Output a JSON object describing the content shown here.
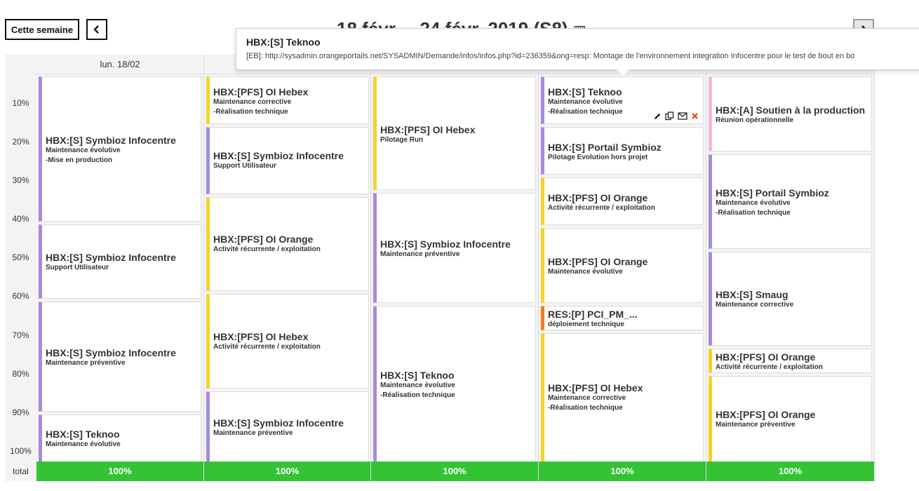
{
  "toolbar": {
    "this_week_label": "Cette semaine",
    "prev_label": "‹",
    "next_label": "›",
    "week_title": "18 févr. – 24 févr. 2019 (S8)"
  },
  "days": [
    {
      "label": "lun. 18/02"
    },
    {
      "label": ""
    },
    {
      "label": ""
    },
    {
      "label": ""
    },
    {
      "label": ""
    }
  ],
  "percent_labels": [
    "10%",
    "20%",
    "30%",
    "40%",
    "50%",
    "60%",
    "70%",
    "80%",
    "90%",
    "100%"
  ],
  "total_label": "total",
  "totals": [
    "100%",
    "100%",
    "100%",
    "100%",
    "100%"
  ],
  "colors": {
    "purple": "#a78bdb",
    "yellow": "#f5d327",
    "orange": "#f47a1f",
    "pink": "#f5b8dc",
    "total_green": "#33c333"
  },
  "events": {
    "d0": [
      {
        "title": "HBX:[S] Symbioz Infocentre",
        "lines": [
          "Maintenance évolutive",
          "-Mise en production"
        ],
        "color": "purple"
      },
      {
        "title": "HBX:[S] Symbioz Infocentre",
        "lines": [
          "Support Utilisateur"
        ],
        "color": "purple"
      },
      {
        "title": "HBX:[S] Symbioz Infocentre",
        "lines": [
          "Maintenance préventive"
        ],
        "color": "purple"
      },
      {
        "title": "HBX:[S] Teknoo",
        "lines": [
          "Maintenance évolutive"
        ],
        "color": "purple"
      }
    ],
    "d1": [
      {
        "title": "HBX:[PFS] OI Hebex",
        "lines": [
          "Maintenance corrective",
          "-Réalisation technique"
        ],
        "color": "yellow"
      },
      {
        "title": "HBX:[S] Symbioz Infocentre",
        "lines": [
          "Support Utilisateur"
        ],
        "color": "purple"
      },
      {
        "title": "HBX:[PFS] OI Orange",
        "lines": [
          "Activité récurrente / exploitation"
        ],
        "color": "yellow"
      },
      {
        "title": "HBX:[PFS] OI Hebex",
        "lines": [
          "Activité récurrente / exploitation"
        ],
        "color": "yellow"
      },
      {
        "title": "HBX:[S] Symbioz Infocentre",
        "lines": [
          "Maintenance préventive"
        ],
        "color": "purple"
      }
    ],
    "d2": [
      {
        "title": "HBX:[PFS] OI Hebex",
        "lines": [
          "Pilotage Run"
        ],
        "color": "yellow"
      },
      {
        "title": "HBX:[S] Symbioz Infocentre",
        "lines": [
          "Maintenance préventive"
        ],
        "color": "purple"
      },
      {
        "title": "HBX:[S] Teknoo",
        "lines": [
          "Maintenance évolutive",
          "-Réalisation technique"
        ],
        "color": "purple"
      }
    ],
    "d3": [
      {
        "title": "HBX:[S] Teknoo",
        "lines": [
          "Maintenance évolutive",
          "-Réalisation technique"
        ],
        "color": "purple"
      },
      {
        "title": "HBX:[S] Portail Symbioz",
        "lines": [
          "Pilotage Evolution hors projet"
        ],
        "color": "purple"
      },
      {
        "title": "HBX:[PFS] OI Orange",
        "lines": [
          "Activité récurrente / exploitation"
        ],
        "color": "yellow"
      },
      {
        "title": "HBX:[PFS] OI Orange",
        "lines": [
          "Maintenance évolutive"
        ],
        "color": "yellow"
      },
      {
        "title": "RES:[P] PCI_PM_...",
        "lines": [
          "déploiement technique"
        ],
        "color": "orange"
      },
      {
        "title": "HBX:[PFS] OI Hebex",
        "lines": [
          "Maintenance corrective",
          "-Réalisation technique"
        ],
        "color": "yellow"
      }
    ],
    "d4": [
      {
        "title": "HBX:[A] Soutien à la production",
        "lines": [
          "Réunion opérationnelle"
        ],
        "color": "pink"
      },
      {
        "title": "HBX:[S] Portail Symbioz",
        "lines": [
          "Maintenance évolutive",
          "-Réalisation technique"
        ],
        "color": "purple"
      },
      {
        "title": "HBX:[S] Smaug",
        "lines": [
          "Maintenance corrective"
        ],
        "color": "purple"
      },
      {
        "title": "HBX:[PFS] OI Orange",
        "lines": [
          "Activité récurrente / exploitation"
        ],
        "color": "yellow"
      },
      {
        "title": "HBX:[PFS] OI Orange",
        "lines": [
          "Maintenance préventive"
        ],
        "color": "yellow"
      }
    ]
  },
  "tooltip": {
    "title": "HBX:[S] Teknoo",
    "description": "[EB]: http://sysadmin.orangeportails.net/SYSADMIN/Demande/infos/infos.php?id=236359&ong=resp: Montage de l'environnement integration Infocentre pour le test de bout en bo"
  },
  "icons": {
    "edit": "pencil-icon",
    "copy": "copy-icon",
    "mail": "envelope-icon",
    "delete": "close-icon",
    "calendar": "calendar-icon"
  }
}
